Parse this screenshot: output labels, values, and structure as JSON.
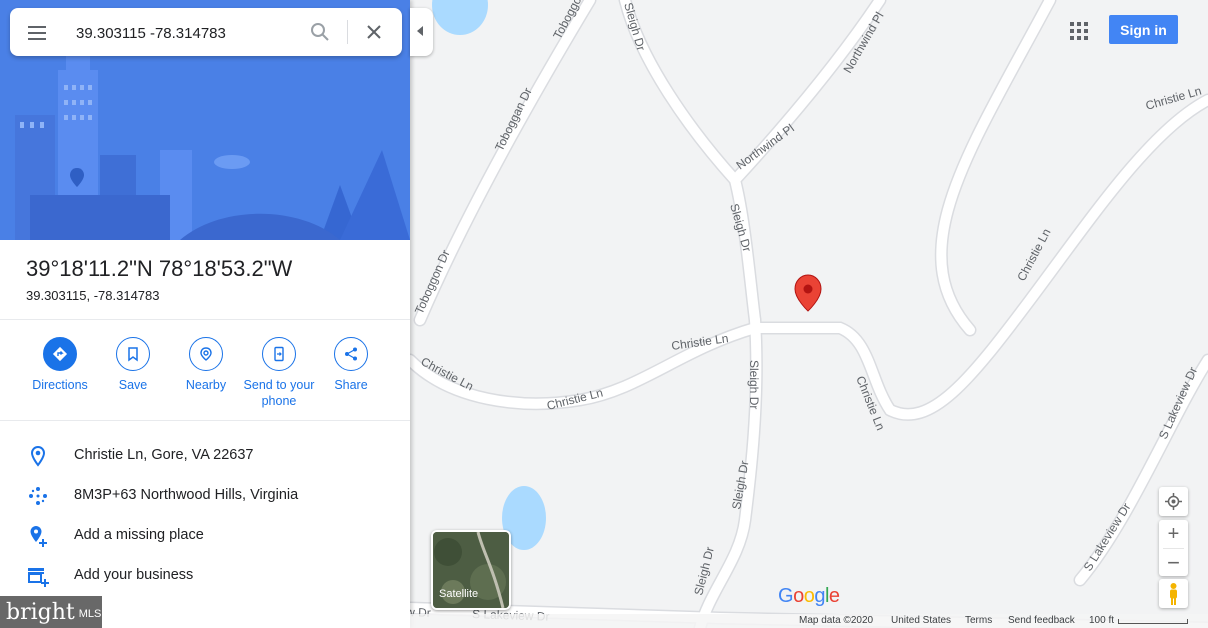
{
  "search": {
    "value": "39.303115 -78.314783"
  },
  "place": {
    "title": "39°18'11.2\"N 78°18'53.2\"W",
    "subtitle": "39.303115, -78.314783"
  },
  "actions": [
    {
      "label": "Directions"
    },
    {
      "label": "Save"
    },
    {
      "label": "Nearby"
    },
    {
      "label": "Send to your phone"
    },
    {
      "label": "Share"
    }
  ],
  "info": [
    {
      "text": "Christie Ln, Gore, VA 22637",
      "icon": "location-pin-icon"
    },
    {
      "text": "8M3P+63 Northwood Hills, Virginia",
      "icon": "plus-code-icon"
    },
    {
      "text": "Add a missing place",
      "icon": "add-place-icon"
    },
    {
      "text": "Add your business",
      "icon": "add-business-icon"
    }
  ],
  "map": {
    "signin_label": "Sign in",
    "satellite_label": "Satellite",
    "logo": "Google",
    "roads": {
      "toboggon_top": "Toboggon Dr",
      "toboggan": "Toboggan Dr",
      "toboggon_mid": "Toboggon Dr",
      "sleigh_top": "Sleigh Dr",
      "sleigh_mid": "Sleigh Dr",
      "sleigh_low1": "Sleigh Dr",
      "sleigh_low2": "Sleigh Dr",
      "sleigh_low3": "Sleigh Dr",
      "northwind_top": "Northwind Pl",
      "northwind_mid": "Northwind Pl",
      "christie_top": "Christie Ln",
      "christie_right": "Christie Ln",
      "christie_center": "Christie Ln",
      "christie_left": "Christie Ln",
      "christie_bottom": "Christie Ln",
      "christie_curve": "Christie Ln",
      "lakeview_right": "S Lakeview Dr",
      "lakeview_low": "S Lakeview Dr",
      "lakeview_bottom": "S Lakeview Dr",
      "partial_dr": "w Dr"
    },
    "colors": {
      "pin": "#ea4335",
      "water": "#aadaff",
      "accent": "#1a73e8"
    }
  },
  "footer": {
    "map_data": "Map data ©2020",
    "country": "United States",
    "terms": "Terms",
    "feedback": "Send feedback",
    "scale": "100 ft"
  },
  "watermark": {
    "brand": "bright",
    "suffix": "MLS"
  }
}
